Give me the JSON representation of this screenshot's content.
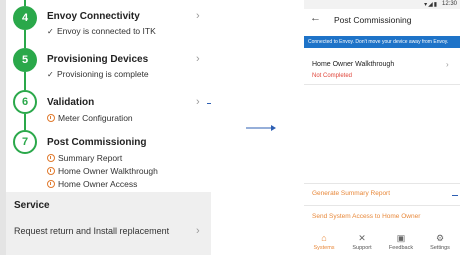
{
  "steps": [
    {
      "number": "4",
      "title": "Envoy Connectivity",
      "sub": [
        "Envoy is connected to ITK"
      ],
      "state": "done"
    },
    {
      "number": "5",
      "title": "Provisioning Devices",
      "sub": [
        "Provisioning is complete"
      ],
      "state": "done"
    },
    {
      "number": "6",
      "title": "Validation",
      "sub": [
        "Meter Configuration"
      ],
      "state": "open"
    },
    {
      "number": "7",
      "title": "Post Commissioning",
      "sub": [
        "Summary Report",
        "Home Owner Walkthrough",
        "Home Owner Access"
      ],
      "state": "open"
    }
  ],
  "service": {
    "title": "Service",
    "item": "Request return and Install replacement"
  },
  "icons": {
    "check": "check-icon",
    "warning": "warning-icon",
    "chevron": "chevron-right-icon",
    "back": "back-arrow-icon"
  },
  "phone": {
    "status_time": "12:30",
    "title": "Post Commissioning",
    "banner": "Connected to Envoy. Don't move your device away from Envoy.",
    "item_title": "Home Owner Walkthrough",
    "item_status": "Not Completed",
    "actions": [
      "Generate Summary Report",
      "Send System Access to Home Owner"
    ],
    "nav": [
      {
        "label": "Systems",
        "icon": "home-icon"
      },
      {
        "label": "Support",
        "icon": "wrench-icon"
      },
      {
        "label": "Feedback",
        "icon": "feedback-icon"
      },
      {
        "label": "Settings",
        "icon": "gear-icon"
      }
    ]
  },
  "colors": {
    "green": "#2aa84a",
    "orange": "#e8883a",
    "blue_banner": "#1e73c8",
    "error": "#e0453a"
  }
}
